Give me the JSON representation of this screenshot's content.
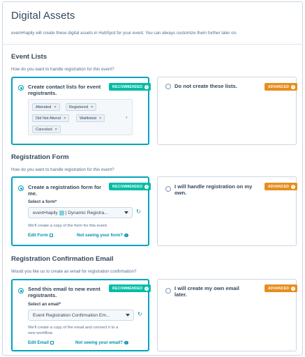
{
  "page": {
    "title": "Digital Assets",
    "subtitle": "event•hapily will create these digital assets in HubSpot for your event. You can always customize them further later on."
  },
  "event_lists": {
    "title": "Event Lists",
    "question": "How do you want to handle registration for this event?",
    "create_option": {
      "label": "Create contact lists for event registrants.",
      "badge": "RECOMMENDED",
      "selected": true,
      "chips": [
        "Attended",
        "Registered",
        "Did Not Attend",
        "Waitlisted",
        "Canceled"
      ]
    },
    "skip_option": {
      "label": "Do not create these lists.",
      "badge": "ADVANCED",
      "selected": false
    }
  },
  "registration_form": {
    "title": "Registration Form",
    "question": "How do you want to handle registration for this event?",
    "create_option": {
      "label": "Create a registration form for me.",
      "badge": "RECOMMENDED",
      "selected": true,
      "field_label": "Select a form*",
      "select_value_prefix": "event•hapily",
      "select_value_suffix": "| Dynamic Registra...",
      "note": "We'll create a copy of the form for this event.",
      "edit_link": "Edit Form",
      "help_link": "Not seeing your form?"
    },
    "own_option": {
      "label": "I will handle registration on my own.",
      "badge": "ADVANCED",
      "selected": false
    }
  },
  "confirmation_email": {
    "title": "Registration Confirmation Email",
    "question": "Would you like us to create an email for registration confirmation?",
    "create_option": {
      "label": "Send this email to new event registrants.",
      "badge": "RECOMMENDED",
      "selected": true,
      "field_label": "Select an email*",
      "select_value": "Event Registration Confirmation Em...",
      "note": "We'll create a copy of the email and connect it to a new workflow.",
      "edit_link": "Edit Email",
      "help_link": "Not seeing your email?"
    },
    "own_option": {
      "label": "I will create my own email later.",
      "badge": "ADVANCED",
      "selected": false
    }
  },
  "colors": {
    "accent": "#00a4bd",
    "recommended": "#00bda5",
    "advanced": "#e68e1e",
    "link": "#0091ae"
  }
}
